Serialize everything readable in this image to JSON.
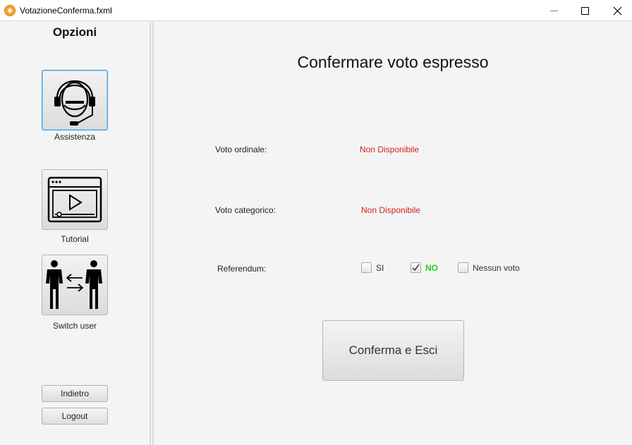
{
  "window": {
    "title": "VotazioneConferma.fxml"
  },
  "sidebar": {
    "title": "Opzioni",
    "items": [
      {
        "label": "Assistenza",
        "icon": "headset-icon"
      },
      {
        "label": "Tutorial",
        "icon": "video-player-icon"
      },
      {
        "label": "Switch user",
        "icon": "switch-user-icon"
      }
    ],
    "back_label": "Indietro",
    "logout_label": "Logout"
  },
  "main": {
    "title": "Confermare voto espresso",
    "voto_ordinale": {
      "label": "Voto ordinale:",
      "value": "Non Disponibile"
    },
    "voto_categorico": {
      "label": "Voto categorico:",
      "value": "Non Disponibile"
    },
    "referendum": {
      "label": "Referendum:",
      "options": [
        {
          "label": "SI",
          "checked": false
        },
        {
          "label": "NO",
          "checked": true
        },
        {
          "label": "Nessun voto",
          "checked": false
        }
      ]
    },
    "confirm_label": "Conferma e Esci"
  },
  "colors": {
    "unavailable": "#d32020",
    "selected_option": "#22d022",
    "focus_border": "#3a9bd9"
  }
}
